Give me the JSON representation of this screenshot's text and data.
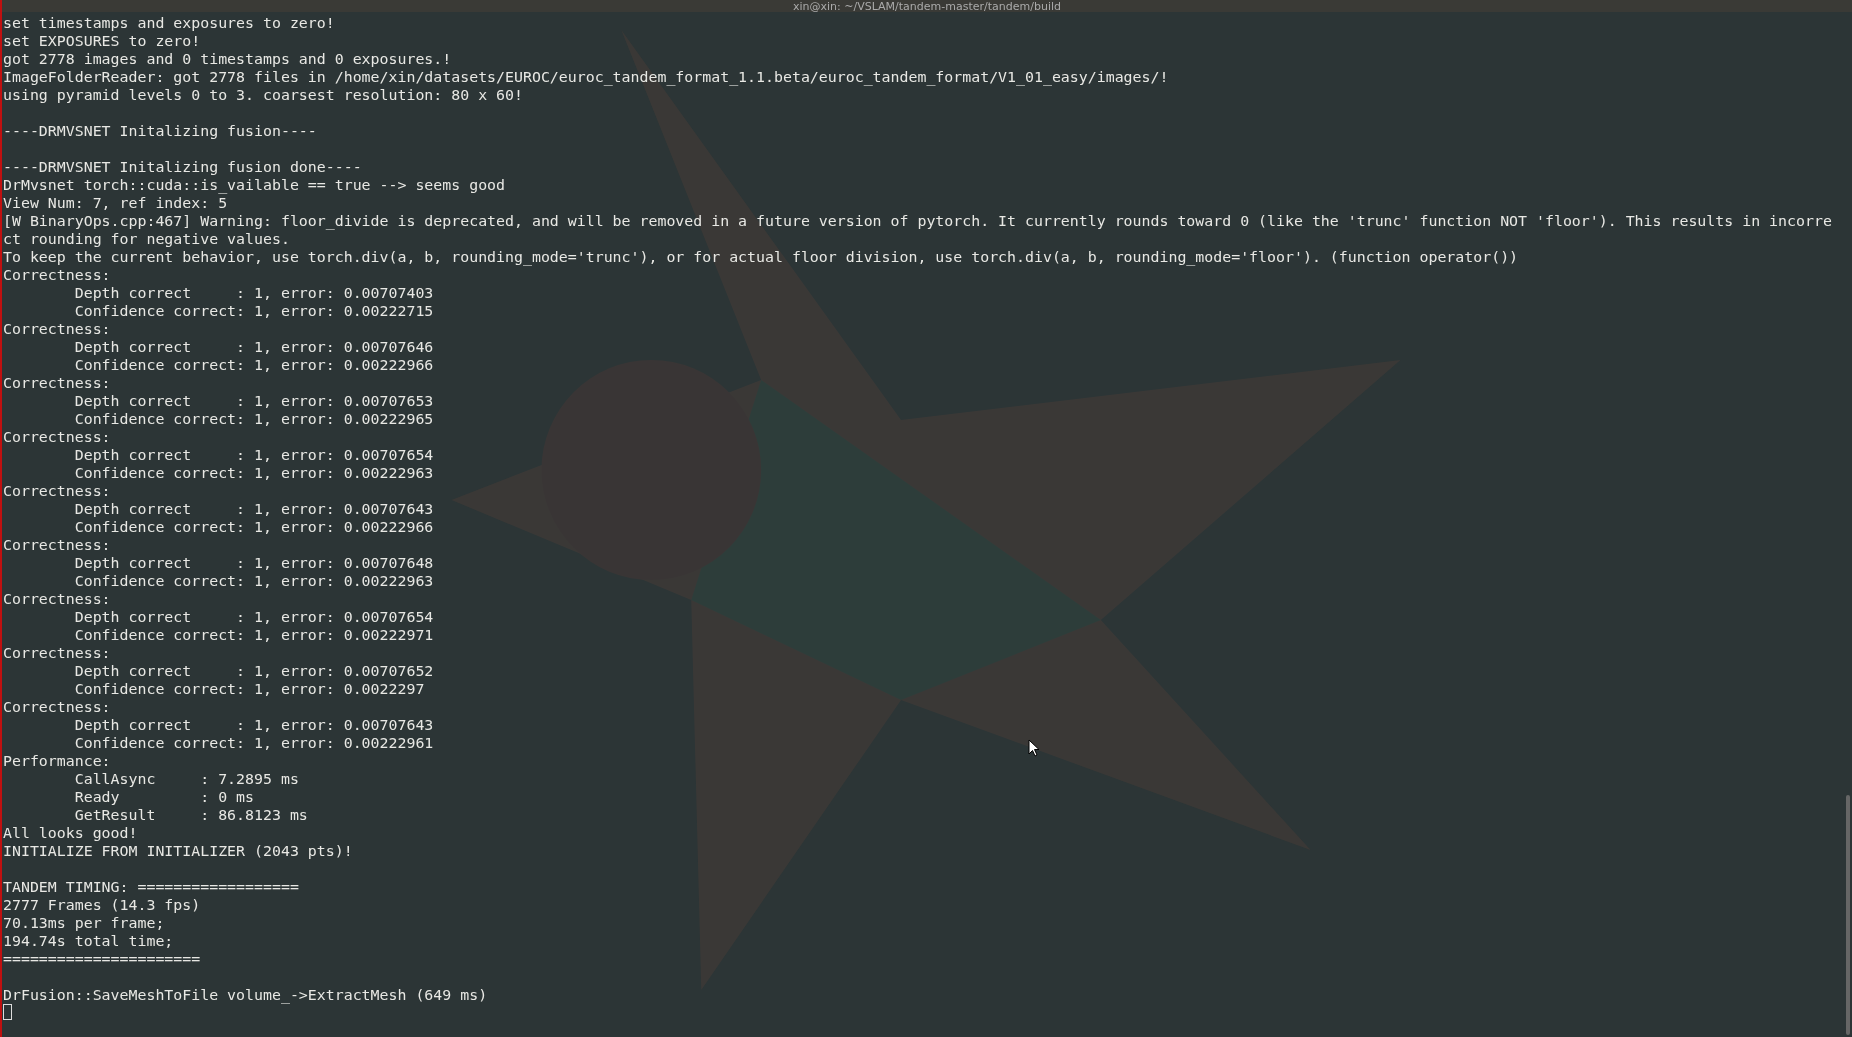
{
  "window": {
    "title": "xin@xin: ~/VSLAM/tandem-master/tandem/build"
  },
  "blocks": [
    [
      "set timestamps and exposures to zero!",
      "set EXPOSURES to zero!",
      "got 2778 images and 0 timestamps and 0 exposures.!",
      "ImageFolderReader: got 2778 files in /home/xin/datasets/EUROC/euroc_tandem_format_1.1.beta/euroc_tandem_format/V1_01_easy/images/!",
      "using pyramid levels 0 to 3. coarsest resolution: 80 x 60!"
    ],
    [
      "----DRMVSNET Initalizing fusion----"
    ],
    [
      "----DRMVSNET Initalizing fusion done----",
      "DrMvsnet torch::cuda::is_vailable == true --> seems good",
      "View Num: 7, ref index: 5",
      "[W BinaryOps.cpp:467] Warning: floor_divide is deprecated, and will be removed in a future version of pytorch. It currently rounds toward 0 (like the 'trunc' function NOT 'floor'). This results in incorre",
      "ct rounding for negative values.",
      "To keep the current behavior, use torch.div(a, b, rounding_mode='trunc'), or for actual floor division, use torch.div(a, b, rounding_mode='floor'). (function operator())",
      "Correctness:",
      "        Depth correct     : 1, error: 0.00707403",
      "        Confidence correct: 1, error: 0.00222715",
      "Correctness:",
      "        Depth correct     : 1, error: 0.00707646",
      "        Confidence correct: 1, error: 0.00222966",
      "Correctness:",
      "        Depth correct     : 1, error: 0.00707653",
      "        Confidence correct: 1, error: 0.00222965",
      "Correctness:",
      "        Depth correct     : 1, error: 0.00707654",
      "        Confidence correct: 1, error: 0.00222963",
      "Correctness:",
      "        Depth correct     : 1, error: 0.00707643",
      "        Confidence correct: 1, error: 0.00222966",
      "Correctness:",
      "        Depth correct     : 1, error: 0.00707648",
      "        Confidence correct: 1, error: 0.00222963",
      "Correctness:",
      "        Depth correct     : 1, error: 0.00707654",
      "        Confidence correct: 1, error: 0.00222971",
      "Correctness:",
      "        Depth correct     : 1, error: 0.00707652",
      "        Confidence correct: 1, error: 0.0022297",
      "Correctness:",
      "        Depth correct     : 1, error: 0.00707643",
      "        Confidence correct: 1, error: 0.00222961",
      "Performance:",
      "        CallAsync     : 7.2895 ms",
      "        Ready         : 0 ms",
      "        GetResult     : 86.8123 ms",
      "All looks good!",
      "INITIALIZE FROM INITIALIZER (2043 pts)!"
    ],
    [
      "TANDEM TIMING: ==================",
      "2777 Frames (14.3 fps)",
      "70.13ms per frame;",
      "194.74s total time;",
      "======================"
    ],
    [
      "DrFusion::SaveMeshToFile volume_->ExtractMesh (649 ms)"
    ]
  ]
}
